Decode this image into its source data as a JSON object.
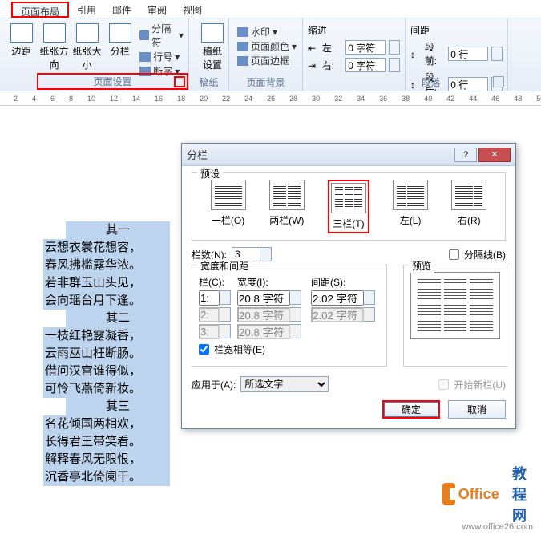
{
  "tabs": {
    "page_layout": "页面布局",
    "references": "引用",
    "mailings": "邮件",
    "review": "审阅",
    "view": "视图"
  },
  "ribbon": {
    "margins": "边距",
    "orientation": "纸张方向",
    "size": "纸张大小",
    "columns": "分栏",
    "breaks": "分隔符",
    "line_numbers": "行号",
    "hyphenation": "断字",
    "page_setup": "页面设置",
    "manuscript": "稿纸\n设置",
    "manuscript_group": "稿纸",
    "watermark": "水印",
    "page_color": "页面颜色",
    "page_borders": "页面边框",
    "page_background": "页面背景",
    "indent": "缩进",
    "indent_left": "左:",
    "indent_right": "右:",
    "indent_left_val": "0 字符",
    "indent_right_val": "0 字符",
    "spacing": "间距",
    "spacing_before": "段前:",
    "spacing_after": "段后:",
    "spacing_before_val": "0 行",
    "spacing_after_val": "0 行",
    "paragraph": "段落"
  },
  "document": {
    "lines": [
      "其一",
      "云想衣裳花想容，",
      "春风拂槛露华浓。",
      "若非群玉山头见，",
      "会向瑶台月下逢。",
      "其二",
      "一枝红艳露凝香，",
      "云雨巫山枉断肠。",
      "借问汉宫谁得似，",
      "可怜飞燕倚新妆。",
      "其三",
      "名花倾国两相欢，",
      "长得君王带笑看。",
      "解释春风无限恨，",
      "沉香亭北倚阑干。"
    ]
  },
  "dialog": {
    "title": "分栏",
    "presets_label": "预设",
    "preset_one": "一栏(O)",
    "preset_two": "两栏(W)",
    "preset_three": "三栏(T)",
    "preset_left": "左(L)",
    "preset_right": "右(R)",
    "num_cols": "栏数(N):",
    "num_cols_val": "3",
    "line_between": "分隔线(B)",
    "width_spacing": "宽度和间距",
    "col_header": "栏(C):",
    "width_header": "宽度(I):",
    "spacing_header": "间距(S):",
    "row1_col": "1:",
    "row1_width": "20.8 字符",
    "row1_spacing": "2.02 字符",
    "row2_col": "2:",
    "row2_width": "20.8 字符",
    "row2_spacing": "2.02 字符",
    "row3_col": "3:",
    "row3_width": "20.8 字符",
    "equal_width": "栏宽相等(E)",
    "preview": "预览",
    "apply_to": "应用于(A):",
    "apply_to_val": "所选文字",
    "start_new": "开始新栏(U)",
    "ok": "确定",
    "cancel": "取消"
  },
  "watermark": {
    "brand1": "Office",
    "brand2": "教程网",
    "url": "www.office26.com"
  }
}
